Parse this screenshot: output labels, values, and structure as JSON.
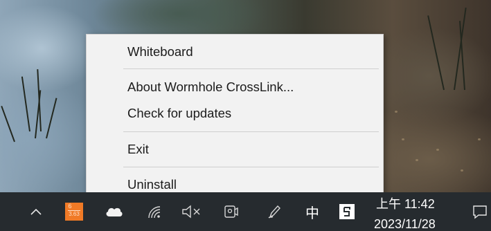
{
  "menu": {
    "items": [
      {
        "label": "Whiteboard"
      },
      {
        "label": "About Wormhole CrossLink..."
      },
      {
        "label": "Check for updates"
      },
      {
        "label": "Exit"
      },
      {
        "label": "Uninstall"
      }
    ]
  },
  "taskbar": {
    "ime_label": "中",
    "clock_time": "上午 11:42",
    "clock_date": "2023/11/28",
    "calendar_badge_top": "6",
    "calendar_badge_bottom": "3.63",
    "icons": [
      "show-hidden-icons-chevron",
      "calendar-app-icon",
      "onedrive-cloud-icon",
      "wifi-icon",
      "speaker-muted-icon",
      "meet-now-icon",
      "pen-icon",
      "input-method-icon",
      "app-tray-icon",
      "notifications-icon"
    ]
  },
  "colors": {
    "menu_background": "#f2f2f2",
    "menu_separator": "#cfcfcf",
    "taskbar_background": "#262b2f",
    "calendar_icon": "#f07a26"
  }
}
